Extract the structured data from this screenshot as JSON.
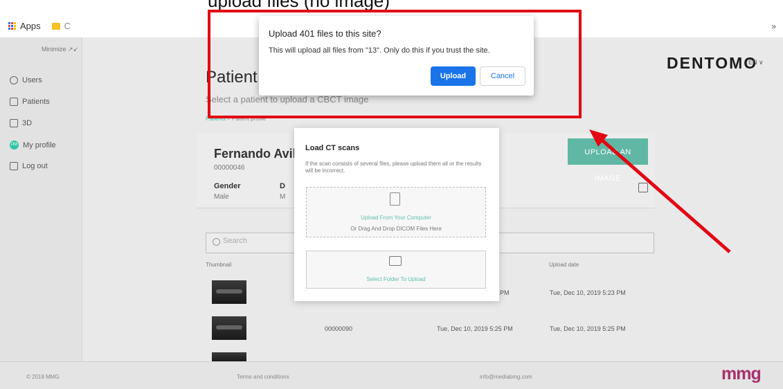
{
  "caption": "upload files (no image)",
  "bookmarks": {
    "apps": "Apps",
    "folder": "C",
    "more": "»"
  },
  "sidebar": {
    "minimize": "Minimize",
    "items": [
      {
        "label": "Users",
        "icon": "users-icon"
      },
      {
        "label": "Patients",
        "icon": "tooth-icon"
      },
      {
        "label": "3D",
        "icon": "cube-icon"
      },
      {
        "label": "My profile",
        "icon": "avatar-icon",
        "initials": "DM"
      },
      {
        "label": "Log out",
        "icon": "logout-icon"
      }
    ]
  },
  "header": {
    "logo": "DENTOMO",
    "lang": "EN ∨"
  },
  "page": {
    "title": "Patient profile",
    "subtitle": "Select a patient to upload a CBCT image",
    "breadcrumb": {
      "root": "Patients",
      "sep": " > ",
      "current": "Patient profile"
    }
  },
  "patient": {
    "name": "Fernando Avilés",
    "id": "00000046",
    "gender_label": "Gender",
    "gender": "Male",
    "dob_label": "D",
    "dob": "M",
    "upload_button": "UPLOAD AN IMAGE"
  },
  "table": {
    "search_placeholder": "Search",
    "headers": [
      "Thumbnail",
      "Upload date"
    ],
    "rows": [
      {
        "id": "",
        "created": "PM",
        "uploaded": "Tue, Dec 10, 2019 5:23 PM"
      },
      {
        "id": "00000090",
        "created": "Tue, Dec 10, 2019 5:25 PM",
        "uploaded": "Tue, Dec 10, 2019 5:25 PM"
      }
    ]
  },
  "modal": {
    "title": "Load CT scans",
    "text": "If the scan consists of several files, please upload them all or the results will be incorrect.",
    "drop_link": "Upload From Your Computer",
    "drop_hint": "Or Drag And Drop DICOM Files Here",
    "folder_link": "Select Folder To Upload"
  },
  "dialog": {
    "title": "Upload 401 files to this site?",
    "message": "This will upload all files from \"13\". Only do this if you trust the site.",
    "upload": "Upload",
    "cancel": "Cancel"
  },
  "footer": {
    "copyright": "© 2019 MMG",
    "terms": "Terms and conditions",
    "email": "info@mediabmg.com",
    "brand": "mmg"
  },
  "colors": {
    "accent": "#5fb7a4",
    "chrome_blue": "#1a73e8",
    "annotation_red": "#e30613",
    "brand_mmg": "#a8306e"
  }
}
